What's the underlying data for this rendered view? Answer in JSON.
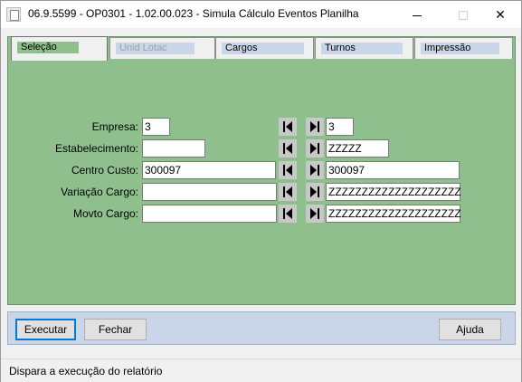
{
  "window": {
    "title": "06.9.5599 - OP0301 - 1.02.00.023 - Simula Cálculo Eventos Planilha",
    "minimize_icon": "minimize-icon",
    "maximize_icon": "maximize-icon",
    "close_glyph": "✕"
  },
  "tabs": [
    {
      "label": "Seleção",
      "state": "active"
    },
    {
      "label": "Unid Lotac",
      "state": "disabled"
    },
    {
      "label": "Cargos",
      "state": "enabled"
    },
    {
      "label": "Turnos",
      "state": "enabled"
    },
    {
      "label": "Impressão",
      "state": "enabled"
    }
  ],
  "form": {
    "rows": [
      {
        "label": "Empresa:",
        "from": "3",
        "to": "3"
      },
      {
        "label": "Estabelecimento:",
        "from": "",
        "to": "ZZZZZ"
      },
      {
        "label": "Centro Custo:",
        "from": "300097",
        "to": "300097"
      },
      {
        "label": "Variação Cargo:",
        "from": "",
        "to": "ZZZZZZZZZZZZZZZZZZZZ"
      },
      {
        "label": "Movto Cargo:",
        "from": "",
        "to": "ZZZZZZZZZZZZZZZZZZZZ"
      }
    ],
    "first_icon": "first-record-icon",
    "last_icon": "last-record-icon"
  },
  "buttons": {
    "execute": "Executar",
    "close": "Fechar",
    "help": "Ajuda"
  },
  "statusbar": {
    "text": "Dispara a execução do relatório"
  },
  "colors": {
    "panel": "#8fbf8c",
    "button_bar": "#c8d6e8",
    "focus": "#0078d7"
  }
}
